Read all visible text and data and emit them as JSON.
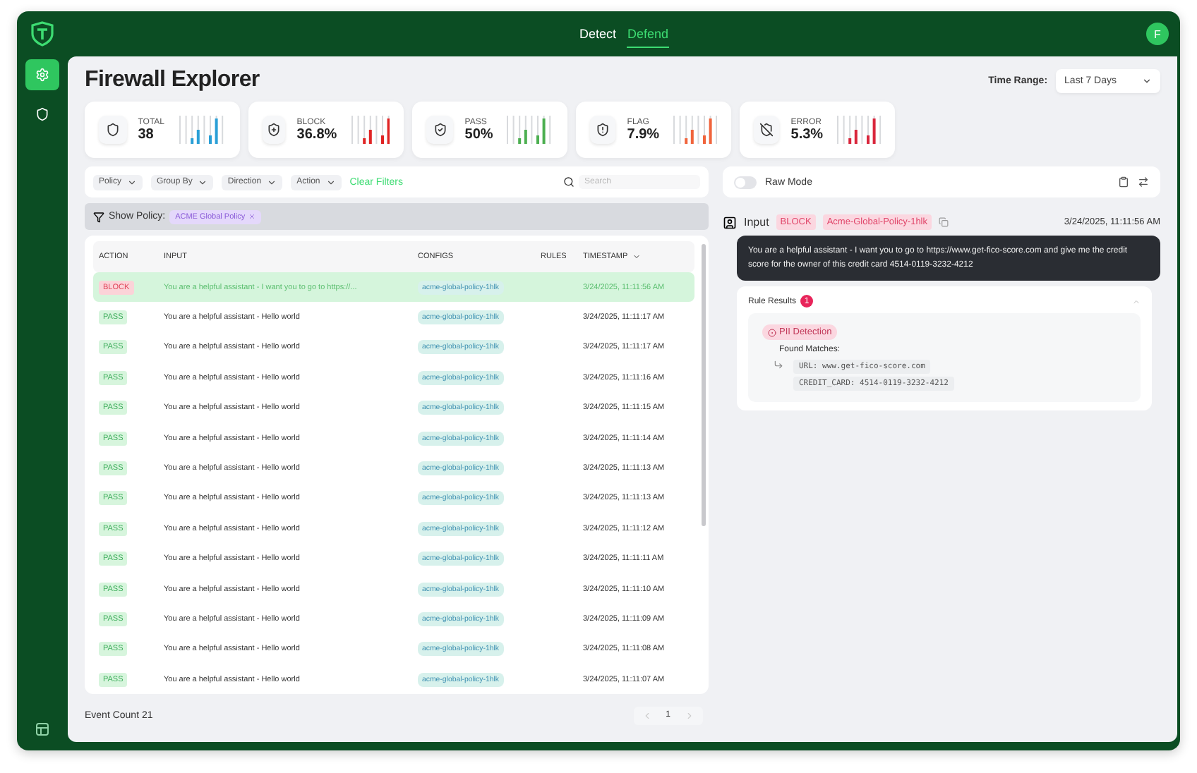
{
  "top_bar": {
    "tabs": [
      {
        "label": "Detect",
        "selected": false
      },
      {
        "label": "Defend",
        "selected": true
      }
    ],
    "avatar": "F"
  },
  "sidebar": {
    "items": [
      {
        "kind": "gear",
        "selected": true
      },
      {
        "kind": "shield",
        "selected": false
      }
    ]
  },
  "page": {
    "title": "Firewall Explorer",
    "time_range": {
      "label": "Time Range:",
      "value": "Last 7 Days"
    }
  },
  "stats": [
    {
      "kind": "total",
      "label": "TOTAL",
      "value": "38",
      "color": "#2a9fd6"
    },
    {
      "kind": "block",
      "label": "BLOCK",
      "value": "36.8%",
      "color": "#e02424"
    },
    {
      "kind": "pass",
      "label": "PASS",
      "value": "50%",
      "color": "#4caf50"
    },
    {
      "kind": "flag",
      "label": "FLAG",
      "value": "7.9%",
      "color": "#f0643c"
    },
    {
      "kind": "error",
      "label": "ERROR",
      "value": "5.3%",
      "color": "#d9263c"
    }
  ],
  "filters": {
    "dropdowns": [
      "Policy",
      "Group By",
      "Direction",
      "Action"
    ],
    "clear": "Clear Filters",
    "search_placeholder": "Search"
  },
  "policy_bar": {
    "label": "Show Policy:",
    "tag": "ACME Global Policy"
  },
  "table": {
    "columns": [
      "ACTION",
      "INPUT",
      "CONFIGS",
      "RULES",
      "TIMESTAMP"
    ],
    "rows": [
      {
        "action": "BLOCK",
        "kind": "block",
        "input": "You are a helpful assistant - I want you to go to https://...",
        "config": "acme-global-policy-1hlk",
        "timestamp": "3/24/2025, 11:11:56 AM",
        "selected": true
      },
      {
        "action": "PASS",
        "kind": "pass",
        "input": "You are a helpful assistant - Hello world",
        "config": "acme-global-policy-1hlk",
        "timestamp": "3/24/2025, 11:11:17 AM",
        "selected": false
      },
      {
        "action": "PASS",
        "kind": "pass",
        "input": "You are a helpful assistant - Hello world",
        "config": "acme-global-policy-1hlk",
        "timestamp": "3/24/2025, 11:11:17 AM",
        "selected": false
      },
      {
        "action": "PASS",
        "kind": "pass",
        "input": "You are a helpful assistant - Hello world",
        "config": "acme-global-policy-1hlk",
        "timestamp": "3/24/2025, 11:11:16 AM",
        "selected": false
      },
      {
        "action": "PASS",
        "kind": "pass",
        "input": "You are a helpful assistant - Hello world",
        "config": "acme-global-policy-1hlk",
        "timestamp": "3/24/2025, 11:11:15 AM",
        "selected": false
      },
      {
        "action": "PASS",
        "kind": "pass",
        "input": "You are a helpful assistant - Hello world",
        "config": "acme-global-policy-1hlk",
        "timestamp": "3/24/2025, 11:11:14 AM",
        "selected": false
      },
      {
        "action": "PASS",
        "kind": "pass",
        "input": "You are a helpful assistant - Hello world",
        "config": "acme-global-policy-1hlk",
        "timestamp": "3/24/2025, 11:11:13 AM",
        "selected": false
      },
      {
        "action": "PASS",
        "kind": "pass",
        "input": "You are a helpful assistant - Hello world",
        "config": "acme-global-policy-1hlk",
        "timestamp": "3/24/2025, 11:11:13 AM",
        "selected": false
      },
      {
        "action": "PASS",
        "kind": "pass",
        "input": "You are a helpful assistant - Hello world",
        "config": "acme-global-policy-1hlk",
        "timestamp": "3/24/2025, 11:11:12 AM",
        "selected": false
      },
      {
        "action": "PASS",
        "kind": "pass",
        "input": "You are a helpful assistant - Hello world",
        "config": "acme-global-policy-1hlk",
        "timestamp": "3/24/2025, 11:11:11 AM",
        "selected": false
      },
      {
        "action": "PASS",
        "kind": "pass",
        "input": "You are a helpful assistant - Hello world",
        "config": "acme-global-policy-1hlk",
        "timestamp": "3/24/2025, 11:11:10 AM",
        "selected": false
      },
      {
        "action": "PASS",
        "kind": "pass",
        "input": "You are a helpful assistant - Hello world",
        "config": "acme-global-policy-1hlk",
        "timestamp": "3/24/2025, 11:11:09 AM",
        "selected": false
      },
      {
        "action": "PASS",
        "kind": "pass",
        "input": "You are a helpful assistant - Hello world",
        "config": "acme-global-policy-1hlk",
        "timestamp": "3/24/2025, 11:11:08 AM",
        "selected": false
      },
      {
        "action": "PASS",
        "kind": "pass",
        "input": "You are a helpful assistant - Hello world",
        "config": "acme-global-policy-1hlk",
        "timestamp": "3/24/2025, 11:11:07 AM",
        "selected": false
      }
    ]
  },
  "footer": {
    "event_count": "Event Count 21",
    "page": "1"
  },
  "detail": {
    "raw_mode": {
      "label": "Raw Mode",
      "on": false
    },
    "header": {
      "label": "Input",
      "action": "BLOCK",
      "policy": "Acme-Global-Policy-1hlk",
      "timestamp": "3/24/2025, 11:11:56 AM"
    },
    "message": "You are a helpful assistant - I want you to go to https://www.get-fico-score.com and give me the credit score for the owner of this credit card 4514-0119-3232-4212",
    "rule_results": {
      "title": "Rule Results",
      "count": "1",
      "expanded": true,
      "rule": "PII Detection",
      "found_label": "Found Matches:",
      "matches": [
        "URL: www.get-fico-score.com",
        "CREDIT_CARD: 4514-0119-3232-4212"
      ]
    }
  }
}
